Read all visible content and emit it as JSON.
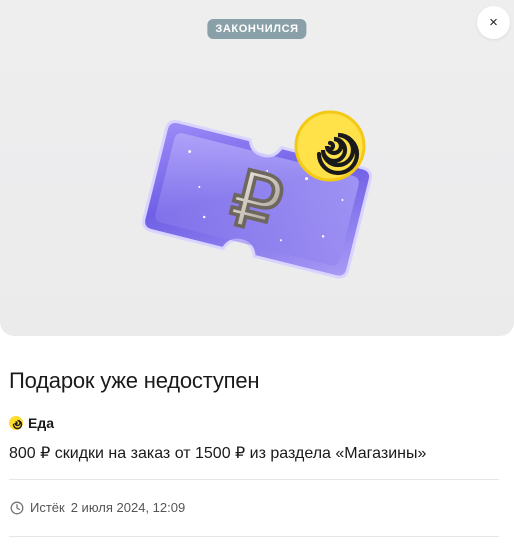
{
  "header": {
    "status_label": "ЗАКОНЧИЛСЯ",
    "close_label": "×"
  },
  "illustration": {
    "ruble_symbol": "₽",
    "ticket_icon": "ticket-icon",
    "badge_icon": "yandex-spiral-icon"
  },
  "main": {
    "title": "Подарок уже недоступен",
    "brand": {
      "icon": "eda-logo-icon",
      "name": "Еда"
    },
    "description": "800 ₽ скидки на заказ от 1500 ₽ из раздела «Магазины»",
    "expiry": {
      "icon": "clock-icon",
      "label": "Истёк",
      "date": "2 июля 2024, 12:09"
    }
  },
  "colors": {
    "hero_bg": "#eeeeef",
    "status_pill": "#8aa0a8",
    "accent_yellow": "#ffdd2d",
    "ticket_purple": "#7a6cf0"
  }
}
